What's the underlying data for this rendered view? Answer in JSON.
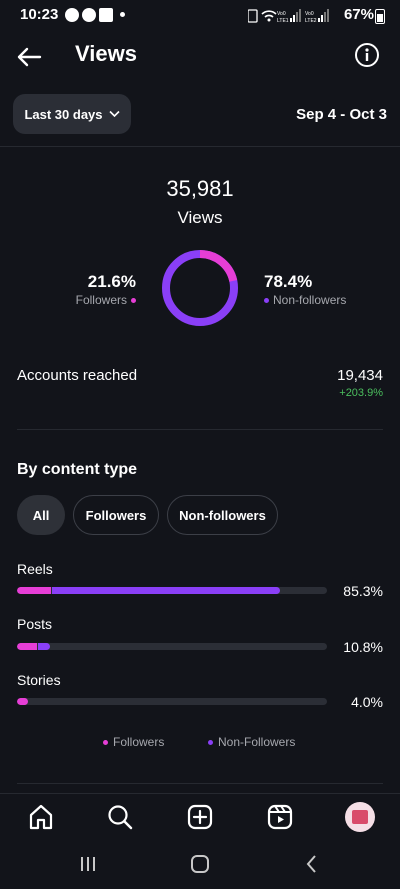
{
  "status_bar": {
    "time": "10:23",
    "battery": "67%"
  },
  "header": {
    "title": "Views"
  },
  "filter": {
    "range_label": "Last 30 days",
    "date_range": "Sep 4 - Oct 3"
  },
  "summary": {
    "total": "35,981",
    "label": "Views",
    "followers_pct": "21.6%",
    "followers_label": "Followers",
    "nonfollowers_pct": "78.4%",
    "nonfollowers_label": "Non-followers",
    "followers_fraction": 0.216
  },
  "accounts": {
    "label": "Accounts reached",
    "value": "19,434",
    "change": "+203.9%"
  },
  "content_type": {
    "title": "By content type",
    "chips": [
      "All",
      "Followers",
      "Non-followers"
    ],
    "rows": [
      {
        "label": "Reels",
        "pct": "85.3%",
        "followers": 0.11,
        "nonfollowers": 0.74
      },
      {
        "label": "Posts",
        "pct": "10.8%",
        "followers": 0.065,
        "nonfollowers": 0.04
      },
      {
        "label": "Stories",
        "pct": "4.0%",
        "followers": 0.035,
        "nonfollowers": 0.0
      }
    ],
    "legend": {
      "followers": "Followers",
      "nonfollowers": "Non-Followers"
    }
  },
  "colors": {
    "followers": "#e63ed6",
    "nonfollowers": "#8a3ff7",
    "positive": "#4bbf5e"
  },
  "icons": [
    "home-icon",
    "search-icon",
    "create-icon",
    "reels-icon",
    "avatar"
  ]
}
